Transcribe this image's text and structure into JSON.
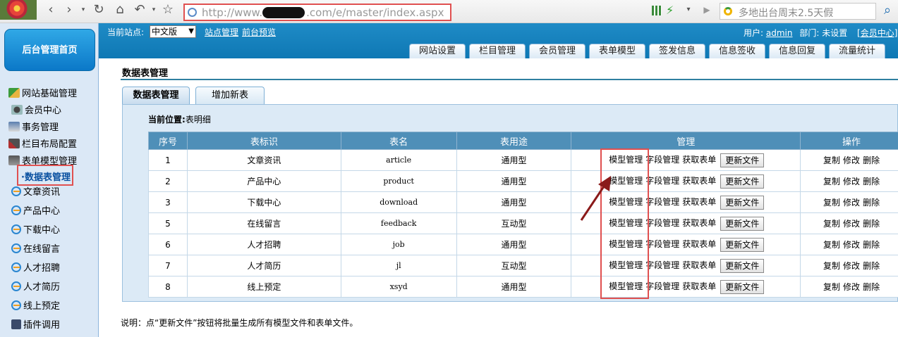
{
  "browser": {
    "url": "http://www.",
    "url_suffix": ".com/e/master/index.aspx",
    "search_text": "多地出台周末2.5天假"
  },
  "topbar": {
    "site_label": "当前站点:",
    "site_select_value": "中文版",
    "links": [
      "站点管理",
      "前台预览"
    ],
    "user_label": "用户:",
    "user_name": "admin",
    "dept_label": "部门:",
    "dept_value": "未设置",
    "member_center": "[会员中心]",
    "tabs": [
      "网站设置",
      "栏目管理",
      "会员管理",
      "表单模型",
      "签发信息",
      "信息签收",
      "信息回复",
      "流量统计"
    ]
  },
  "sidebar": {
    "home": "后台管理首页",
    "items": [
      "网站基础管理",
      "会员中心",
      "事务管理",
      "栏目布局配置",
      "表单模型管理"
    ],
    "active_sub": "·数据表管理",
    "sub_items": [
      "文章资讯",
      "产品中心",
      "下载中心",
      "在线留言",
      "人才招聘",
      "人才简历",
      "线上预定",
      "插件调用"
    ]
  },
  "main": {
    "title": "数据表管理",
    "subtabs": [
      "数据表管理",
      "增加新表"
    ],
    "location_label": "当前位置:",
    "location_value": "表明细",
    "columns": [
      "序号",
      "表标识",
      "表名",
      "表用途",
      "管理",
      "操作"
    ],
    "rows": [
      {
        "id": "1",
        "label": "文章资讯",
        "name": "article",
        "use": "通用型"
      },
      {
        "id": "2",
        "label": "产品中心",
        "name": "product",
        "use": "通用型"
      },
      {
        "id": "3",
        "label": "下载中心",
        "name": "download",
        "use": "通用型"
      },
      {
        "id": "5",
        "label": "在线留言",
        "name": "feedback",
        "use": "互动型"
      },
      {
        "id": "6",
        "label": "人才招聘",
        "name": "job",
        "use": "通用型"
      },
      {
        "id": "7",
        "label": "人才简历",
        "name": "jl",
        "use": "互动型"
      },
      {
        "id": "8",
        "label": "线上预定",
        "name": "xsyd",
        "use": "通用型"
      }
    ],
    "manage_actions": [
      "模型管理",
      "字段管理",
      "获取表单"
    ],
    "update_button": "更新文件",
    "ops": [
      "复制",
      "修改",
      "删除"
    ],
    "note": "说明：点“更新文件”按钮将批量生成所有模型文件和表单文件。"
  },
  "colors": {
    "topbar": "#1f8bc6",
    "highlight": "#e05050",
    "table_header": "#4f8fb8"
  }
}
